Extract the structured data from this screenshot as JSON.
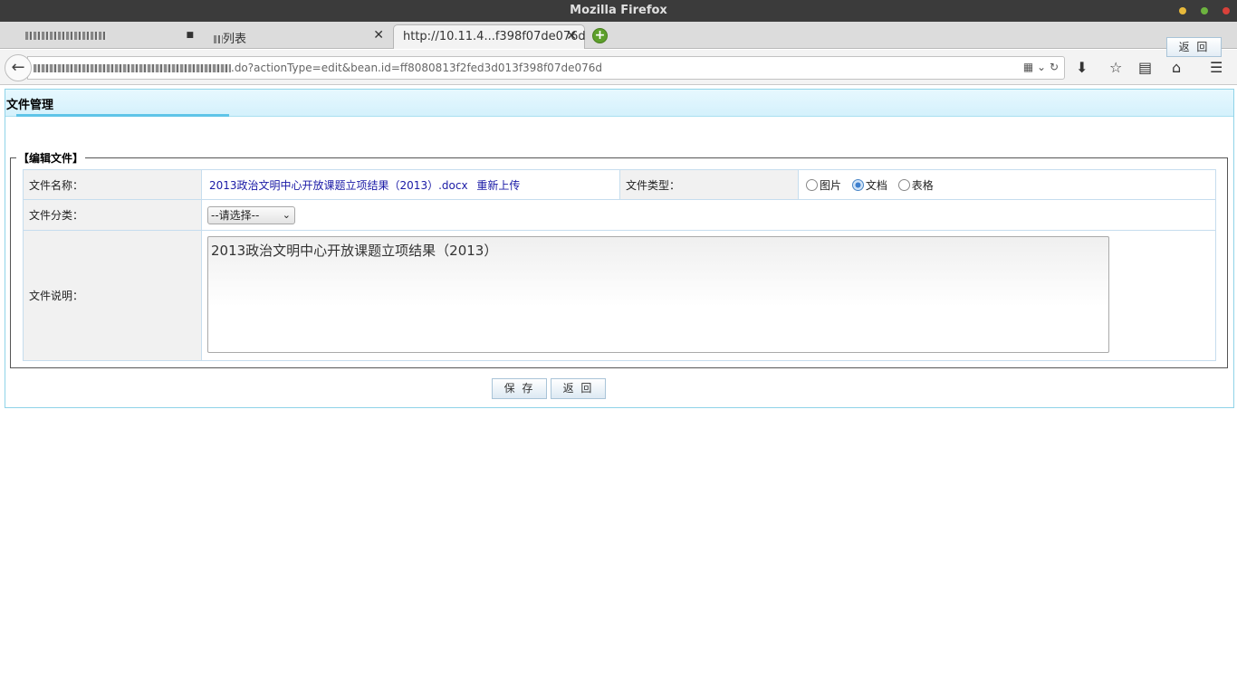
{
  "window": {
    "title": "Mozilla Firefox"
  },
  "tabs": [
    {
      "label": "",
      "blurred": true
    },
    {
      "label": "列表",
      "blurred_prefix": true
    },
    {
      "label": "http://10.11.4...f398f07de076d",
      "active": true
    }
  ],
  "navbar": {
    "url_tail": ".do?actionType=edit&bean.id=ff8080813f2fed3d013f398f07de076d"
  },
  "page": {
    "header_title": "文件管理",
    "back_top": "返 回",
    "legend": "【编辑文件】",
    "form": {
      "file_name_label": "文件名称：",
      "file_name_value": "2013政治文明中心开放课题立项结果（2013）.docx",
      "reupload_link": "重新上传",
      "file_type_label": "文件类型：",
      "file_type_options": [
        "图片",
        "文档",
        "表格"
      ],
      "file_type_selected": "文档",
      "category_label": "文件分类：",
      "category_selected": "--请选择--",
      "description_label": "文件说明：",
      "description_value": "2013政治文明中心开放课题立项结果（2013）"
    },
    "save_button": "保 存",
    "back_button": "返 回"
  },
  "colors": {
    "window_dot_1": "#e7b93b",
    "window_dot_2": "#6db33f",
    "window_dot_3": "#d9413a"
  }
}
